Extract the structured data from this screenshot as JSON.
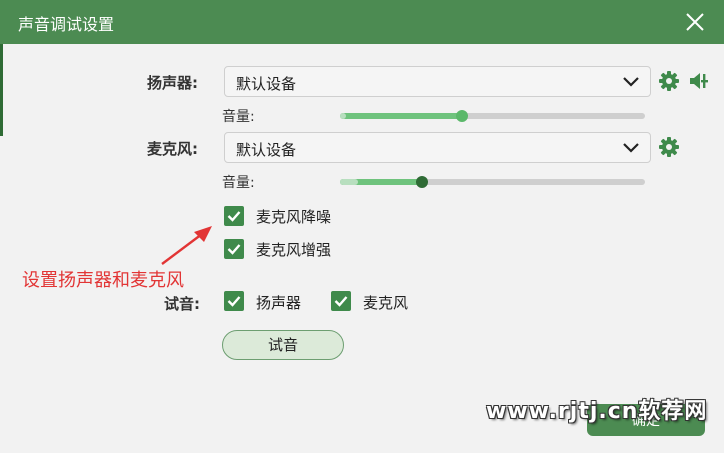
{
  "window": {
    "title": "声音调试设置",
    "accent": "#4c8b52"
  },
  "speaker": {
    "label": "扬声器:",
    "device": "默认设备",
    "volume_label": "音量:",
    "volume": 0.4,
    "level": 0.02
  },
  "mic": {
    "label": "麦克风:",
    "device": "默认设备",
    "volume_label": "音量:",
    "volume": 0.27,
    "level": 0.06
  },
  "options": [
    {
      "label": "麦克风降噪",
      "checked": true
    },
    {
      "label": "麦克风增强",
      "checked": true
    }
  ],
  "test": {
    "label": "试音:",
    "targets": [
      {
        "label": "扬声器",
        "checked": true
      },
      {
        "label": "麦克风",
        "checked": true
      }
    ],
    "button": "试音"
  },
  "annotation": "设置扬声器和麦克风",
  "ok_button": "确定",
  "watermark": "www.rjtj.cn软荐网",
  "icons": [
    "close-icon",
    "chevron-down-icon",
    "gear-icon",
    "speaker-volume-icon",
    "checkmark-icon",
    "arrow-icon"
  ]
}
